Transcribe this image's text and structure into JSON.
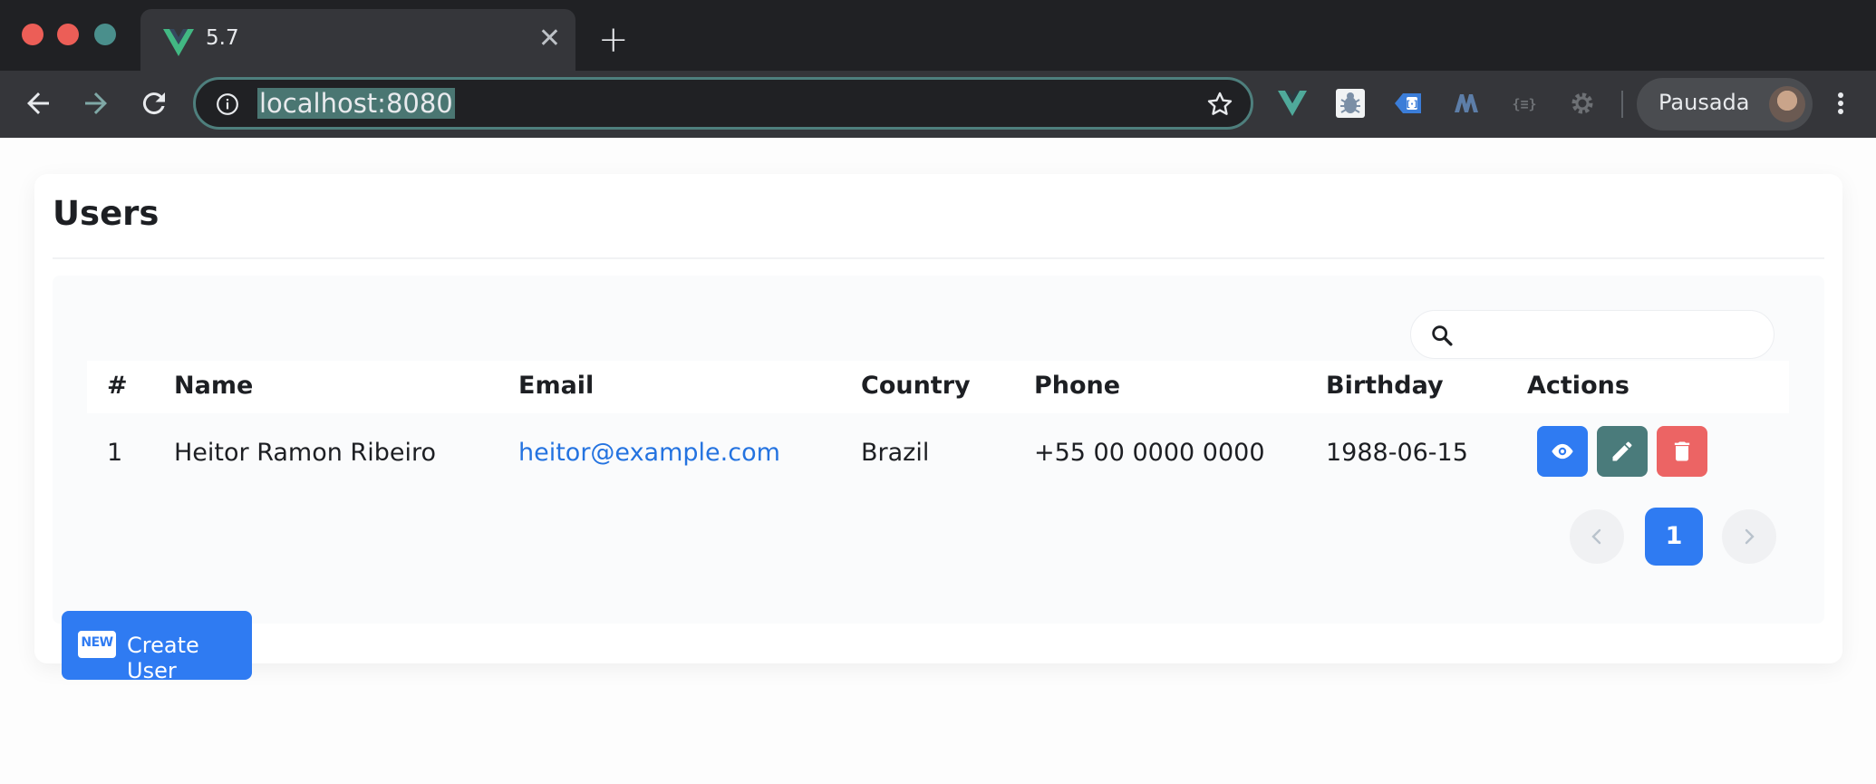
{
  "browser": {
    "tab_title": "5.7",
    "url": "localhost:8080",
    "profile_label": "Pausada",
    "extensions": [
      "vue-devtools-icon",
      "bug-icon",
      "tag-icon",
      "m-icon",
      "json-icon",
      "gear-icon"
    ]
  },
  "page": {
    "title": "Users",
    "search": {
      "placeholder": "",
      "value": ""
    },
    "table": {
      "columns": [
        "#",
        "Name",
        "Email",
        "Country",
        "Phone",
        "Birthday",
        "Actions"
      ],
      "rows": [
        {
          "index": "1",
          "name": "Heitor Ramon Ribeiro",
          "email": "heitor@example.com",
          "country": "Brazil",
          "phone": "+55 00 0000 0000",
          "birthday": "1988-06-15"
        }
      ]
    },
    "pagination": {
      "current": "1"
    },
    "create_button": {
      "badge": "NEW",
      "label": "Create User"
    }
  },
  "colors": {
    "primary": "#2f7bf2",
    "edit": "#4a7b7b",
    "delete": "#ec6464",
    "link": "#2473e0"
  }
}
